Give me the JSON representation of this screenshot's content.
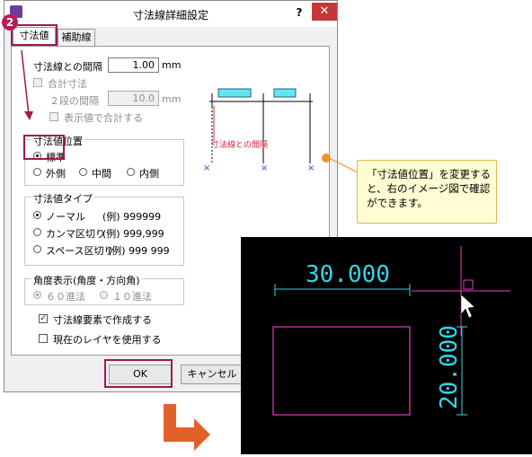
{
  "dialog": {
    "title": "寸法線詳細設定",
    "help_label": "?",
    "close_label": "✕",
    "tabs": [
      "寸法値",
      "補助線"
    ],
    "gap_label": "寸法線との間隔",
    "gap_value": "1.00",
    "gap_unit": "mm",
    "total_check_label": "合計寸法",
    "second_gap_label": "２段の間隔",
    "second_gap_value": "10.0",
    "second_gap_unit": "mm",
    "show_total_label": "表示値で合計する",
    "position_group": {
      "title": "寸法値位置",
      "options": [
        "標準",
        "外側",
        "中間",
        "内側"
      ],
      "selected": "標準"
    },
    "type_group": {
      "title": "寸法値タイプ",
      "options": [
        {
          "label": "ノーマル",
          "example": "(例) 999999"
        },
        {
          "label": "カンマ区切り",
          "example": "(例) 999,999"
        },
        {
          "label": "スペース区切り",
          "example": "(例) 999 999"
        }
      ],
      "selected": "ノーマル"
    },
    "angle_group": {
      "title": "角度表示(角度・方向角)",
      "options": [
        "６０進法",
        "１０進法"
      ],
      "selected": "６０進法"
    },
    "create_element_label": "寸法線要素で作成する",
    "create_element_checked": true,
    "use_current_layer_label": "現在のレイヤを使用する",
    "use_current_layer_checked": false,
    "ok_label": "OK",
    "cancel_label": "キャンセル"
  },
  "preview": {
    "dimension_line_text": "寸法線との間隔"
  },
  "step_marker": "2",
  "callout": {
    "text": "「寸法値位置」を変更すると、右のイメージ図で確認ができます。"
  },
  "cad": {
    "horizontal_dimension": "30.000",
    "vertical_dimension": "20.000"
  },
  "colors": {
    "highlight": "#a01852",
    "close_button": "#c83737",
    "callout_bg": "#fffbd2",
    "callout_border": "#e3b74f",
    "arrow": "#e0622a",
    "cad_dimension": "#35d4e8",
    "cad_shape": "#e040c8"
  }
}
